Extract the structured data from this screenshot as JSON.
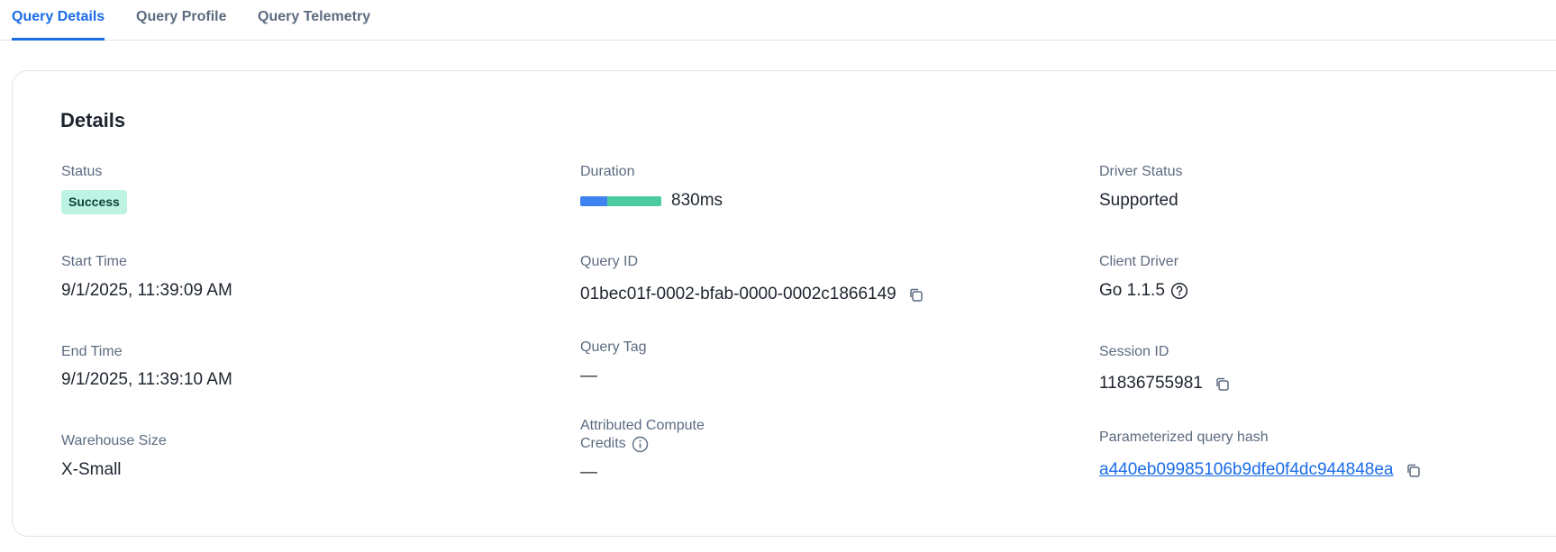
{
  "tabs": [
    {
      "label": "Query Details",
      "active": true
    },
    {
      "label": "Query Profile",
      "active": false
    },
    {
      "label": "Query Telemetry",
      "active": false
    }
  ],
  "details": {
    "title": "Details",
    "status": {
      "label": "Status",
      "value": "Success",
      "color": "#bdf3e3"
    },
    "duration": {
      "label": "Duration",
      "value": "830ms",
      "bar_fraction": 0.33,
      "bar_colors": [
        "#3f83f0",
        "#4ccb9e"
      ]
    },
    "driver_status": {
      "label": "Driver Status",
      "value": "Supported"
    },
    "start_time": {
      "label": "Start Time",
      "value": "9/1/2025, 11:39:09 AM"
    },
    "query_id": {
      "label": "Query ID",
      "value": "01bec01f-0002-bfab-0000-0002c1866149"
    },
    "client_driver": {
      "label": "Client Driver",
      "value": "Go 1.1.5"
    },
    "end_time": {
      "label": "End Time",
      "value": "9/1/2025, 11:39:10 AM"
    },
    "query_tag": {
      "label": "Query Tag",
      "value": "—"
    },
    "session_id": {
      "label": "Session ID",
      "value": "11836755981"
    },
    "warehouse_size": {
      "label": "Warehouse Size",
      "value": "X-Small"
    },
    "attributed_credits": {
      "label_line1": "Attributed Compute",
      "label_line2": "Credits",
      "value": "—"
    },
    "query_hash": {
      "label": "Parameterized query hash",
      "value": "a440eb09985106b9dfe0f4dc944848ea"
    }
  },
  "icons": {
    "copy": "copy-icon",
    "help": "question-circle-icon",
    "info": "info-circle-icon"
  },
  "colors": {
    "accent": "#1a6ce7",
    "label": "#5c6b80",
    "text": "#1e252f"
  }
}
